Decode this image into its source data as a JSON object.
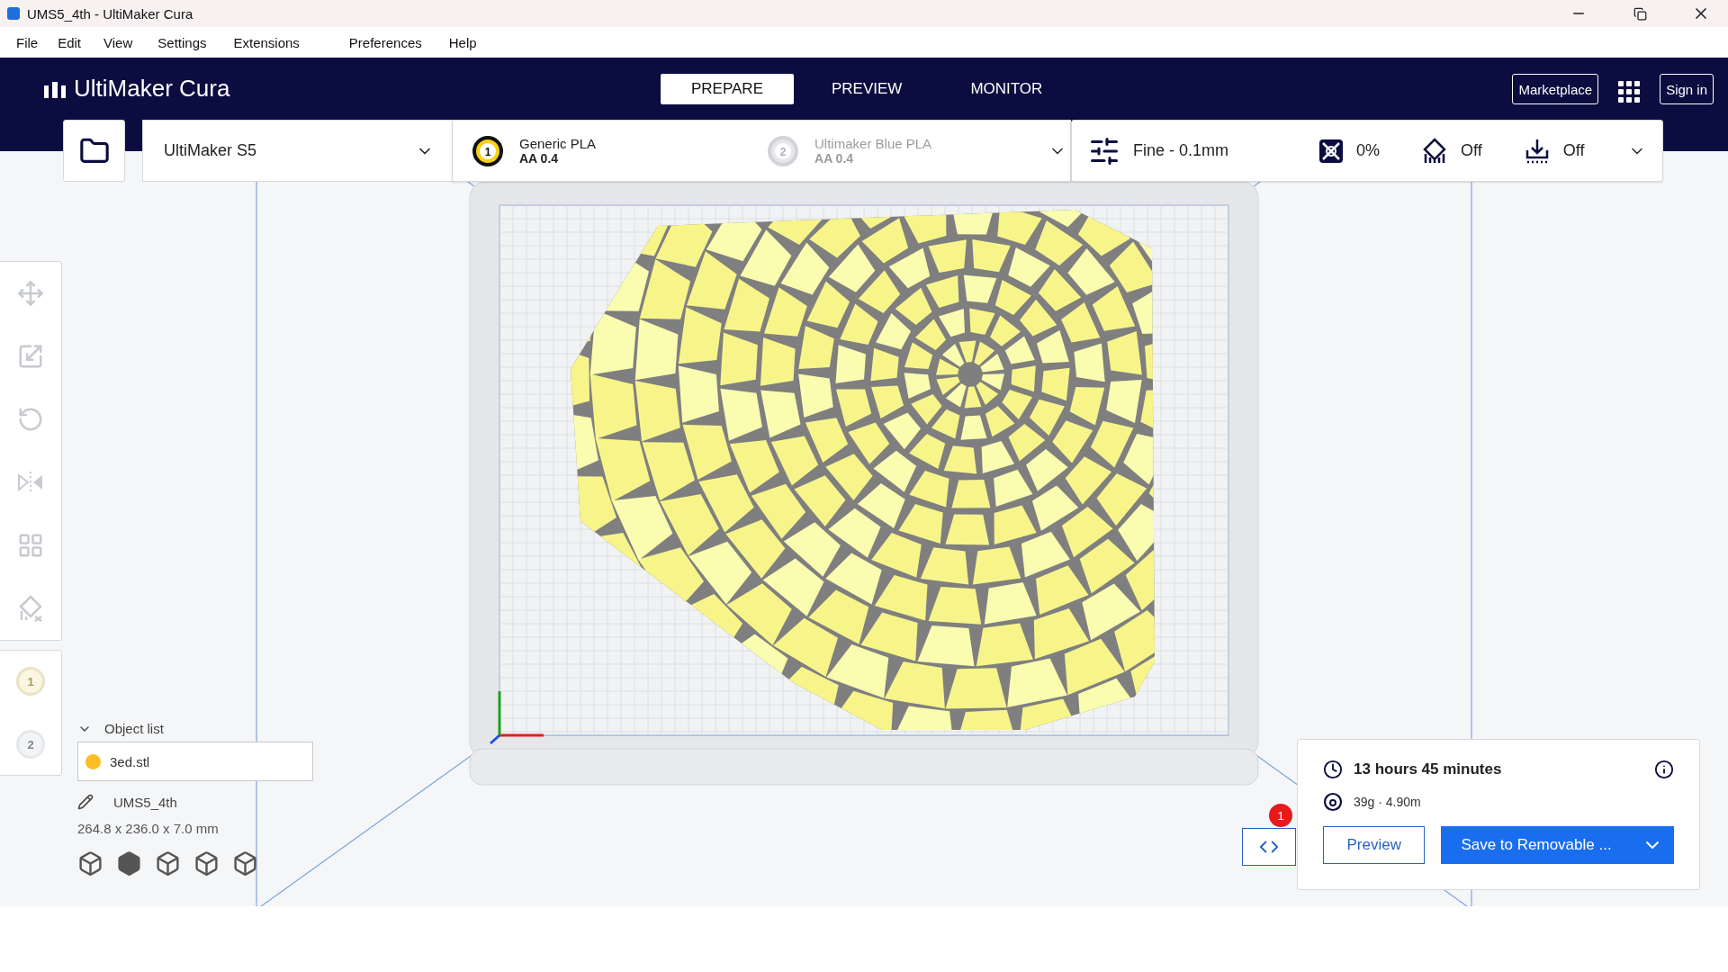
{
  "window": {
    "title": "UMS5_4th - UltiMaker Cura"
  },
  "menu": [
    "File",
    "Edit",
    "View",
    "Settings",
    "Extensions",
    "Preferences",
    "Help"
  ],
  "header": {
    "logo": "UltiMaker Cura",
    "marketplace": "Marketplace",
    "sign_in": "Sign in",
    "tabs": [
      {
        "label": "PREPARE",
        "selected": true
      },
      {
        "label": "PREVIEW",
        "selected": false
      },
      {
        "label": "MONITOR",
        "selected": false
      }
    ]
  },
  "printer": {
    "name": "UltiMaker S5"
  },
  "extruders": [
    {
      "number": "1",
      "material": "Generic PLA",
      "core": "AA 0.4",
      "enabled": true
    },
    {
      "number": "2",
      "material": "Ultimaker Blue PLA",
      "core": "AA 0.4",
      "enabled": false
    }
  ],
  "print_settings": {
    "profile": "Fine - 0.1mm",
    "infill": "0%",
    "support": "Off",
    "adhesion": "Off"
  },
  "extruder_buttons": [
    {
      "number": "1",
      "enabled": true
    },
    {
      "number": "2",
      "enabled": false
    }
  ],
  "object_list": {
    "title": "Object list",
    "expanded": true,
    "items": [
      {
        "name": "3ed.stl",
        "color": "#fbbf24"
      }
    ]
  },
  "project": {
    "name": "UMS5_4th",
    "dimensions": "264.8 x 236.0 x 7.0 mm"
  },
  "notifications": {
    "count": "1"
  },
  "print_info": {
    "time": "13 hours 45 minutes",
    "material": "39g · 4.90m",
    "preview": "Preview",
    "save": "Save to Removable ..."
  }
}
